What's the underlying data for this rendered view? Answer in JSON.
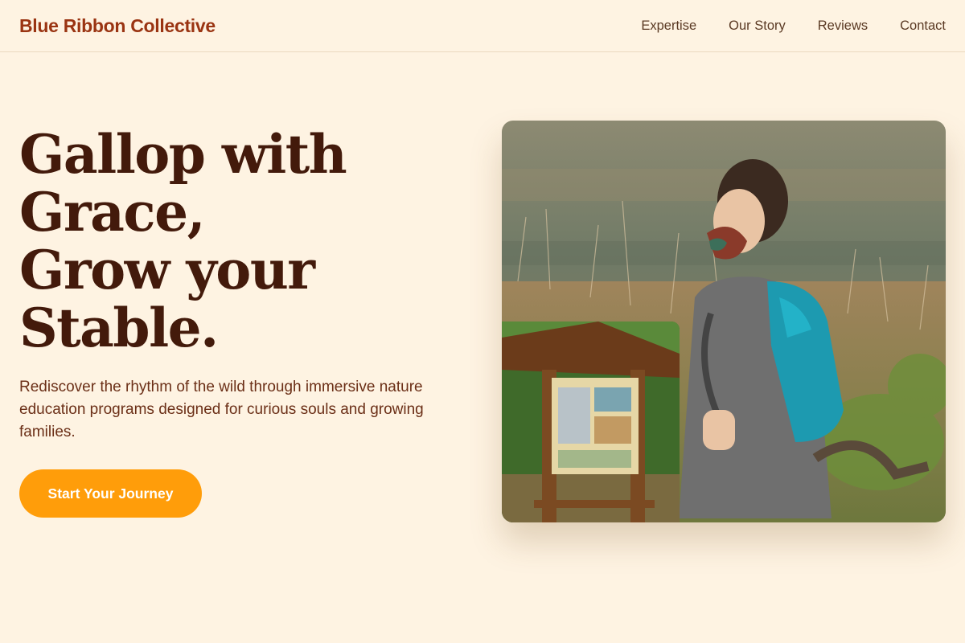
{
  "header": {
    "brand": "Blue Ribbon Collective",
    "nav": [
      "Expertise",
      "Our Story",
      "Reviews",
      "Contact"
    ]
  },
  "hero": {
    "title_lines": [
      "Gallop with",
      "Grace,",
      "Grow your",
      "Stable."
    ],
    "subtitle": "Rediscover the rhythm of the wild through immersive nature education programs designed for curious souls and growing families.",
    "cta_label": "Start Your Journey"
  },
  "colors": {
    "background": "#fef3e2",
    "brand": "#9a3412",
    "heading": "#431a0b",
    "body": "#6b2f17",
    "cta": "#ff9d0a"
  }
}
